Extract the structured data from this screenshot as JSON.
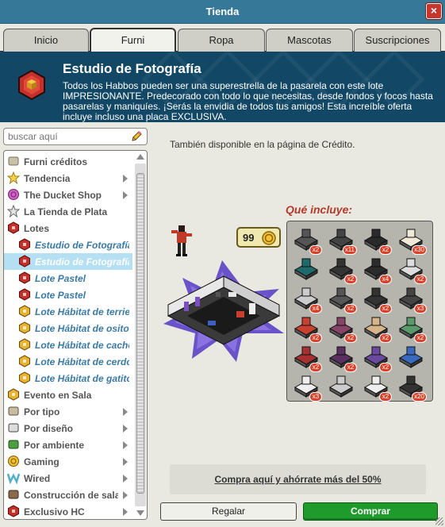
{
  "window": {
    "title": "Tienda",
    "close_label": "×"
  },
  "tabs": [
    {
      "label": "Inicio"
    },
    {
      "label": "Furni"
    },
    {
      "label": "Ropa"
    },
    {
      "label": "Mascotas"
    },
    {
      "label": "Suscripciones"
    }
  ],
  "banner": {
    "title": "Estudio de Fotografía",
    "description": "Todos los Habbos pueden ser una superestrella de la pasarela con este lote IMPRESIONANTE. Predecorado con todo lo que necesitas, desde fondos y focos hasta pasarelas y maniquíes. ¡Serás la envidia de todos tus amigos! Esta increíble oferta incluye incluso una placa EXCLUSIVA."
  },
  "search": {
    "placeholder": "buscar aquí",
    "icon": "pencil-icon"
  },
  "categories": [
    {
      "label": "Furni créditos",
      "icon": "credits-icon",
      "arrow": false,
      "sub": false
    },
    {
      "label": "Tendencia",
      "icon": "star-icon",
      "arrow": true,
      "sub": false
    },
    {
      "label": "The Ducket Shop",
      "icon": "ducket-icon",
      "arrow": true,
      "sub": false
    },
    {
      "label": "La Tienda de Plata",
      "icon": "silver-star-icon",
      "arrow": false,
      "sub": false
    },
    {
      "label": "Lotes",
      "icon": "bundle-icon",
      "arrow": false,
      "sub": false
    },
    {
      "label": "Estudio de Fotografía",
      "icon": "bundle-red-icon",
      "arrow": false,
      "sub": true
    },
    {
      "label": "Estudio de Fotografía",
      "icon": "bundle-red-icon",
      "arrow": false,
      "sub": true,
      "selected": true
    },
    {
      "label": "Lote Pastel",
      "icon": "bundle-red-icon",
      "arrow": false,
      "sub": true
    },
    {
      "label": "Lote Pastel",
      "icon": "bundle-red-icon",
      "arrow": false,
      "sub": true
    },
    {
      "label": "Lote Hábitat de terrier",
      "icon": "bundle-gold-icon",
      "arrow": false,
      "sub": true
    },
    {
      "label": "Lote Hábitat de osito",
      "icon": "bundle-gold-icon",
      "arrow": false,
      "sub": true
    },
    {
      "label": "Lote Hábitat de cachorro",
      "icon": "bundle-gold-icon",
      "arrow": false,
      "sub": true
    },
    {
      "label": "Lote Hábitat de cerdo",
      "icon": "bundle-gold-icon",
      "arrow": false,
      "sub": true
    },
    {
      "label": "Lote Hábitat de gatito",
      "icon": "bundle-gold-icon",
      "arrow": false,
      "sub": true
    },
    {
      "label": "Evento en Sala",
      "icon": "event-icon",
      "arrow": false,
      "sub": false
    },
    {
      "label": "Por tipo",
      "icon": "sofa-icon",
      "arrow": true,
      "sub": false
    },
    {
      "label": "Por diseño",
      "icon": "columns-icon",
      "arrow": true,
      "sub": false
    },
    {
      "label": "Por ambiente",
      "icon": "plant-icon",
      "arrow": true,
      "sub": false
    },
    {
      "label": "Gaming",
      "icon": "trophy-icon",
      "arrow": true,
      "sub": false
    },
    {
      "label": "Wired",
      "icon": "wired-icon",
      "arrow": true,
      "sub": false
    },
    {
      "label": "Construcción de salas",
      "icon": "hammer-icon",
      "arrow": true,
      "sub": false
    },
    {
      "label": "Exclusivo HC",
      "icon": "hc-icon",
      "arrow": true,
      "sub": false
    }
  ],
  "main": {
    "credit_note": "También disponible en la página de Crédito.",
    "price": "99",
    "includes_title": "Qué incluye:",
    "items": [
      {
        "icon": "floor-tile-icon",
        "count": "x2",
        "color": "#555555"
      },
      {
        "icon": "dark-tile-icon",
        "count": "x11",
        "color": "#444444"
      },
      {
        "icon": "avatar-pose-icon",
        "count": "x2",
        "color": "#2a2a2a"
      },
      {
        "icon": "white-rug-icon",
        "count": "x30",
        "color": "#f0e8d8"
      },
      {
        "icon": "screen-icon",
        "count": "",
        "color": "#1e6b6b"
      },
      {
        "icon": "chair-icon",
        "count": "x2",
        "color": "#333333"
      },
      {
        "icon": "sofa-black-icon",
        "count": "x4",
        "color": "#2b2b2b"
      },
      {
        "icon": "spotlight-icon",
        "count": "x2",
        "color": "#dddddd"
      },
      {
        "icon": "round-table-icon",
        "count": "x4",
        "color": "#cccccc"
      },
      {
        "icon": "locker-icon",
        "count": "x2",
        "color": "#555555"
      },
      {
        "icon": "mannequin-icon",
        "count": "x2",
        "color": "#333333"
      },
      {
        "icon": "rope-post-icon",
        "count": "x3",
        "color": "#444444"
      },
      {
        "icon": "camera-icon",
        "count": "x2",
        "color": "#c94030"
      },
      {
        "icon": "stripe-panel-icon",
        "count": "x2",
        "color": "#884466"
      },
      {
        "icon": "desk-icon",
        "count": "x2",
        "color": "#d8b48a"
      },
      {
        "icon": "fridge-icon",
        "count": "x2",
        "color": "#5a9a6a"
      },
      {
        "icon": "red-chair-icon",
        "count": "x2",
        "color": "#a83030"
      },
      {
        "icon": "purple-armchair-icon",
        "count": "x2",
        "color": "#5a3060"
      },
      {
        "icon": "violet-armchair-icon",
        "count": "x2",
        "color": "#6a4aa0"
      },
      {
        "icon": "blue-lamp-icon",
        "count": "",
        "color": "#3a6ac0"
      },
      {
        "icon": "white-mannequin-icon",
        "count": "x3",
        "color": "#eeeeee"
      },
      {
        "icon": "computer-desk-icon",
        "count": "",
        "color": "#cccccc"
      },
      {
        "icon": "white-chair-icon",
        "count": "x2",
        "color": "#eeeeee"
      },
      {
        "icon": "black-stage-icon",
        "count": "x20",
        "color": "#333333"
      }
    ],
    "promo_link": "Compra aquí y ahórrate más del 50%"
  },
  "buttons": {
    "gift": "Regalar",
    "buy": "Comprar"
  },
  "colors": {
    "titlebar": "#367897",
    "banner": "#124866",
    "buy": "#1f9b2c",
    "selected_row": "#b5dff2",
    "link_sub": "#3a7aa5"
  }
}
